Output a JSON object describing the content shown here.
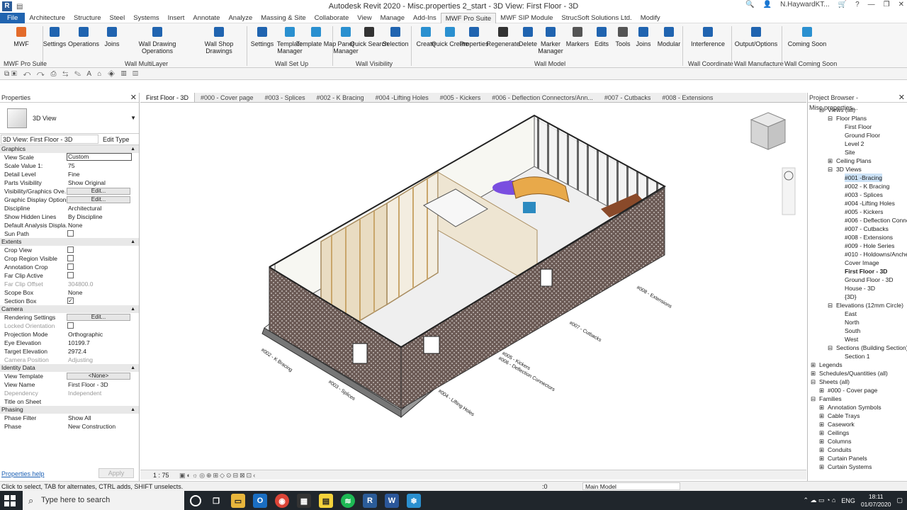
{
  "window": {
    "title": "Autodesk Revit 2020 - Misc.properties 2_start - 3D View: First Floor - 3D",
    "user": "N.HaywardKT..."
  },
  "menu": {
    "tabs": [
      "File",
      "Architecture",
      "Structure",
      "Steel",
      "Systems",
      "Insert",
      "Annotate",
      "Analyze",
      "Massing & Site",
      "Collaborate",
      "View",
      "Manage",
      "Add-Ins",
      "MWF Pro Suite",
      "MWF SIP Module",
      "StrucSoft Solutions Ltd.",
      "Modify"
    ],
    "active": "MWF Pro Suite"
  },
  "ribbon": {
    "buttons": [
      "MWF",
      "Settings",
      "Operations",
      "Joins",
      "Wall Drawing Operations",
      "Wall Shop Drawings",
      "Settings",
      "Template Manager",
      "Template Map",
      "Panel Manager",
      "Quick Search",
      "Selection",
      "Create",
      "Quick Create",
      "Properties",
      "Regenerate",
      "Delete",
      "Marker Manager",
      "Markers",
      "Edits",
      "Tools",
      "Joins",
      "Modular",
      "Interference",
      "Output/Options",
      "Coming Soon"
    ],
    "panels": [
      "MWF Pro Suite",
      "Wall MultiLayer",
      "Wall Set Up",
      "Wall Visibility",
      "Wall Model",
      "Wall Coordinate",
      "Wall Manufacture",
      "Wall Coming Soon"
    ]
  },
  "properties": {
    "title": "Properties",
    "type_name": "3D View",
    "instance": "3D View: First Floor - 3D",
    "edit_type": "Edit Type",
    "help": "Properties help",
    "apply": "Apply",
    "sections": [
      {
        "name": "Graphics",
        "rows": [
          {
            "k": "View Scale",
            "v": "Custom",
            "t": "input"
          },
          {
            "k": "Scale Value    1:",
            "v": "75"
          },
          {
            "k": "Detail Level",
            "v": "Fine"
          },
          {
            "k": "Parts Visibility",
            "v": "Show Original"
          },
          {
            "k": "Visibility/Graphics Ove...",
            "v": "Edit...",
            "t": "btn"
          },
          {
            "k": "Graphic Display Options",
            "v": "Edit...",
            "t": "btn"
          },
          {
            "k": "Discipline",
            "v": "Architectural"
          },
          {
            "k": "Show Hidden Lines",
            "v": "By Discipline"
          },
          {
            "k": "Default Analysis Displa...",
            "v": "None"
          },
          {
            "k": "Sun Path",
            "v": "",
            "t": "cb"
          }
        ]
      },
      {
        "name": "Extents",
        "rows": [
          {
            "k": "Crop View",
            "v": "",
            "t": "cb"
          },
          {
            "k": "Crop Region Visible",
            "v": "",
            "t": "cb"
          },
          {
            "k": "Annotation Crop",
            "v": "",
            "t": "cb"
          },
          {
            "k": "Far Clip Active",
            "v": "",
            "t": "cb"
          },
          {
            "k": "Far Clip Offset",
            "v": "304800.0",
            "t": "dis"
          },
          {
            "k": "Scope Box",
            "v": "None"
          },
          {
            "k": "Section Box",
            "v": "✓",
            "t": "cb"
          }
        ]
      },
      {
        "name": "Camera",
        "rows": [
          {
            "k": "Rendering Settings",
            "v": "Edit...",
            "t": "btn"
          },
          {
            "k": "Locked Orientation",
            "v": "",
            "t": "cbdis"
          },
          {
            "k": "Projection Mode",
            "v": "Orthographic"
          },
          {
            "k": "Eye Elevation",
            "v": "10199.7"
          },
          {
            "k": "Target Elevation",
            "v": "2972.4"
          },
          {
            "k": "Camera Position",
            "v": "Adjusting",
            "t": "dis"
          }
        ]
      },
      {
        "name": "Identity Data",
        "rows": [
          {
            "k": "View Template",
            "v": "<None>",
            "t": "btn"
          },
          {
            "k": "View Name",
            "v": "First Floor - 3D"
          },
          {
            "k": "Dependency",
            "v": "Independent",
            "t": "dis"
          },
          {
            "k": "Title on Sheet",
            "v": ""
          }
        ]
      },
      {
        "name": "Phasing",
        "rows": [
          {
            "k": "Phase Filter",
            "v": "Show All"
          },
          {
            "k": "Phase",
            "v": "New Construction"
          }
        ]
      }
    ]
  },
  "view_tabs": [
    "First Floor - 3D",
    "#000 - Cover page",
    "#003 - Splices",
    "#002 - K Bracing",
    "#004 -Lifting Holes",
    "#005 - Kickers",
    "#006 - Deflection Connectors/Ann...",
    "#007 - Cutbacks",
    "#008 - Extensions"
  ],
  "view_scale": "1 : 75",
  "model_labels": [
    "#002 - K Bracing",
    "#003 - Splices",
    "#004 - Lifting Holes",
    "#005 - Kickers",
    "#006 - Deflection Connectors",
    "#007 - Cutbacks",
    "#008 - Extensions"
  ],
  "browser": {
    "title": "Project Browser - Misc.properties...",
    "items": [
      {
        "t": "Views (all)",
        "d": 1,
        "tg": "−"
      },
      {
        "t": "Floor Plans",
        "d": 2,
        "tg": "−"
      },
      {
        "t": "First Floor",
        "d": 3
      },
      {
        "t": "Ground Floor",
        "d": 3
      },
      {
        "t": "Level 2",
        "d": 3
      },
      {
        "t": "Site",
        "d": 3
      },
      {
        "t": "Ceiling Plans",
        "d": 2,
        "tg": "+"
      },
      {
        "t": "3D Views",
        "d": 2,
        "tg": "−"
      },
      {
        "t": "#001 -Bracing",
        "d": 3,
        "sel": true
      },
      {
        "t": "#002 - K Bracing",
        "d": 3
      },
      {
        "t": "#003 - Splices",
        "d": 3
      },
      {
        "t": "#004 -Lifting Holes",
        "d": 3
      },
      {
        "t": "#005 - Kickers",
        "d": 3
      },
      {
        "t": "#006 - Deflection Conne",
        "d": 3
      },
      {
        "t": "#007 - Cutbacks",
        "d": 3
      },
      {
        "t": "#008 - Extensions",
        "d": 3
      },
      {
        "t": "#009 - Hole Series",
        "d": 3
      },
      {
        "t": "#010 - Holdowns/Anche",
        "d": 3
      },
      {
        "t": "Cover Image",
        "d": 3
      },
      {
        "t": "First Floor - 3D",
        "d": 3,
        "bold": true
      },
      {
        "t": "Ground Floor - 3D",
        "d": 3
      },
      {
        "t": "House - 3D",
        "d": 3
      },
      {
        "t": "{3D}",
        "d": 3
      },
      {
        "t": "Elevations (12mm Circle)",
        "d": 2,
        "tg": "−"
      },
      {
        "t": "East",
        "d": 3
      },
      {
        "t": "North",
        "d": 3
      },
      {
        "t": "South",
        "d": 3
      },
      {
        "t": "West",
        "d": 3
      },
      {
        "t": "Sections (Building Section)",
        "d": 2,
        "tg": "−"
      },
      {
        "t": "Section 1",
        "d": 3
      },
      {
        "t": "Legends",
        "d": 0,
        "tg": "+"
      },
      {
        "t": "Schedules/Quantities (all)",
        "d": 0,
        "tg": "+"
      },
      {
        "t": "Sheets (all)",
        "d": 0,
        "tg": "−"
      },
      {
        "t": "#000 - Cover page",
        "d": 1,
        "tg": "+"
      },
      {
        "t": "Families",
        "d": 0,
        "tg": "−"
      },
      {
        "t": "Annotation Symbols",
        "d": 1,
        "tg": "+"
      },
      {
        "t": "Cable Trays",
        "d": 1,
        "tg": "+"
      },
      {
        "t": "Casework",
        "d": 1,
        "tg": "+"
      },
      {
        "t": "Ceilings",
        "d": 1,
        "tg": "+"
      },
      {
        "t": "Columns",
        "d": 1,
        "tg": "+"
      },
      {
        "t": "Conduits",
        "d": 1,
        "tg": "+"
      },
      {
        "t": "Curtain Panels",
        "d": 1,
        "tg": "+"
      },
      {
        "t": "Curtain Systems",
        "d": 1,
        "tg": "+"
      }
    ]
  },
  "status": {
    "text": "Click to select, TAB for alternates, CTRL adds, SHIFT unselects.",
    "zero": ":0",
    "model": "Main Model"
  },
  "taskbar": {
    "search": "Type here to search",
    "lang": "ENG",
    "time": "18:11",
    "date": "01/07/2020"
  },
  "colors": {
    "accent": "#2064b0",
    "taskbar": "#20262c",
    "wall_board": "#6b5a55",
    "timber": "#d8b784"
  }
}
